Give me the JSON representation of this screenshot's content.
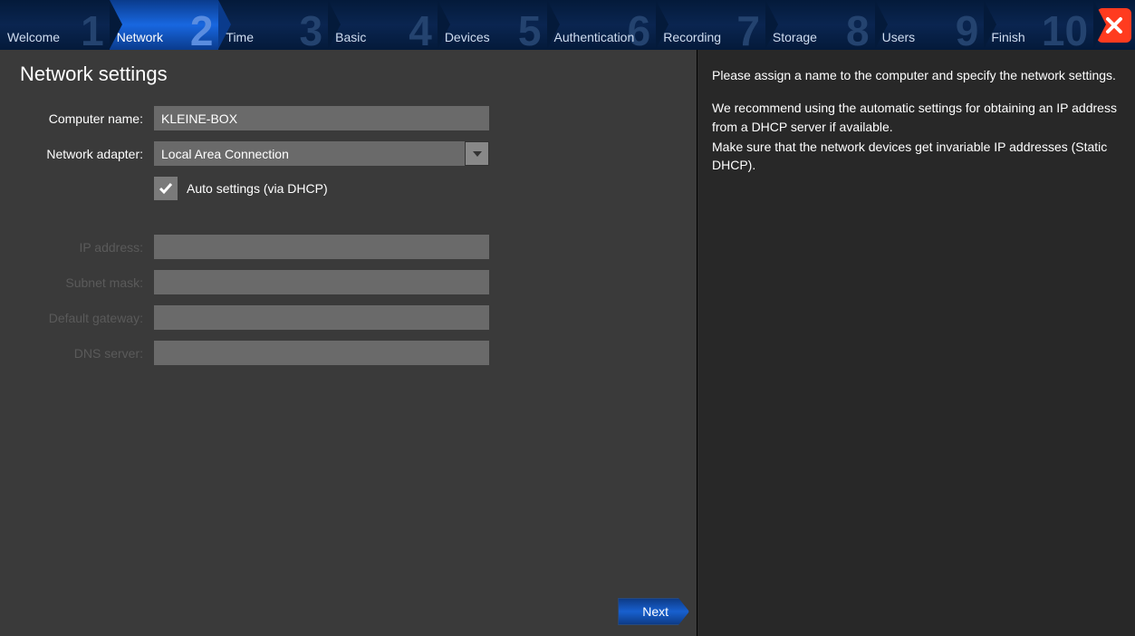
{
  "wizard": {
    "steps": [
      {
        "num": "1",
        "label": "Welcome"
      },
      {
        "num": "2",
        "label": "Network"
      },
      {
        "num": "3",
        "label": "Time"
      },
      {
        "num": "4",
        "label": "Basic"
      },
      {
        "num": "5",
        "label": "Devices"
      },
      {
        "num": "6",
        "label": "Authentication"
      },
      {
        "num": "7",
        "label": "Recording"
      },
      {
        "num": "8",
        "label": "Storage"
      },
      {
        "num": "9",
        "label": "Users"
      },
      {
        "num": "10",
        "label": "Finish"
      }
    ],
    "active_index": 1
  },
  "page": {
    "title": "Network settings"
  },
  "form": {
    "computer_name": {
      "label": "Computer name:",
      "value": "KLEINE-BOX"
    },
    "adapter": {
      "label": "Network adapter:",
      "value": "Local Area Connection"
    },
    "auto_dhcp": {
      "checked": true,
      "label": "Auto settings (via DHCP)"
    },
    "ip": {
      "label": "IP address:",
      "value": ""
    },
    "subnet": {
      "label": "Subnet mask:",
      "value": ""
    },
    "gateway": {
      "label": "Default gateway:",
      "value": ""
    },
    "dns": {
      "label": "DNS server:",
      "value": ""
    }
  },
  "help": {
    "p1": "Please assign a name to the computer and specify the network settings.",
    "p2": "We recommend using the automatic settings for obtaining an IP address from a DHCP server if available.",
    "p3": "Make sure that the network devices get invariable IP addresses (Static DHCP)."
  },
  "buttons": {
    "next": "Next"
  }
}
